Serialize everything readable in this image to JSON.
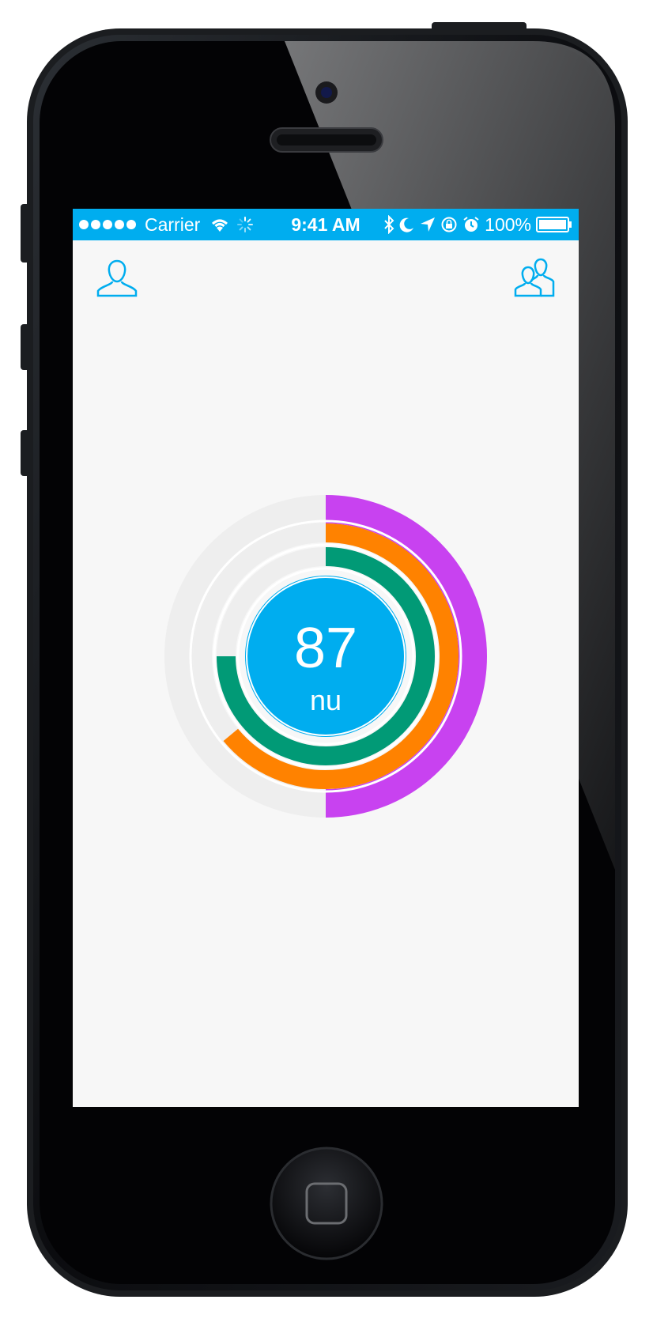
{
  "status_bar": {
    "carrier": "Carrier",
    "time": "9:41 AM",
    "battery": "100%",
    "background": "#00adef",
    "icons": [
      "signal-dots-icon",
      "wifi-icon",
      "activity-spinner-icon",
      "bluetooth-icon",
      "moon-icon",
      "location-arrow-icon",
      "rotation-lock-icon",
      "alarm-icon",
      "battery-icon"
    ]
  },
  "nav": {
    "left_icon": "profile-icon",
    "right_icon": "friends-icon",
    "icon_color": "#00adef"
  },
  "chart_data": {
    "type": "radial",
    "center_value": "87",
    "center_unit": "nu",
    "center_color": "#00adef",
    "track_color": "#eeeeee",
    "rings": [
      {
        "ring": "outer",
        "color": "#c842f0",
        "fraction": 0.5
      },
      {
        "ring": "middle",
        "color": "#ff8200",
        "fraction": 0.64
      },
      {
        "ring": "inner",
        "color": "#019a76",
        "fraction": 0.75
      }
    ]
  }
}
